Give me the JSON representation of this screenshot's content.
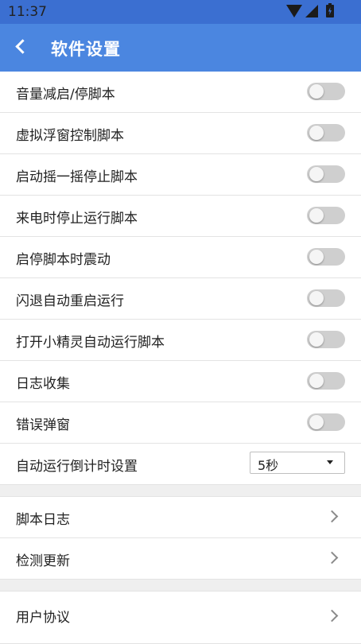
{
  "status_bar": {
    "time": "11:37"
  },
  "app_bar": {
    "title": "软件设置",
    "back_icon": "back-icon"
  },
  "toggles": [
    {
      "label": "音量减启/停脚本",
      "on": false
    },
    {
      "label": "虚拟浮窗控制脚本",
      "on": false
    },
    {
      "label": "启动摇一摇停止脚本",
      "on": false
    },
    {
      "label": "来电时停止运行脚本",
      "on": false
    },
    {
      "label": "启停脚本时震动",
      "on": false
    },
    {
      "label": "闪退自动重启运行",
      "on": false
    },
    {
      "label": "打开小精灵自动运行脚本",
      "on": false
    },
    {
      "label": "日志收集",
      "on": false
    },
    {
      "label": "错误弹窗",
      "on": false
    }
  ],
  "countdown": {
    "label": "自动运行倒计时设置",
    "value": "5秒"
  },
  "links_group1": [
    {
      "label": "脚本日志"
    },
    {
      "label": "检测更新"
    }
  ],
  "links_group2": [
    {
      "label": "用户协议"
    }
  ],
  "colors": {
    "status_bar": "#3b6fd1",
    "app_bar": "#4b86e0",
    "toggle_off": "#cfcfcf"
  }
}
